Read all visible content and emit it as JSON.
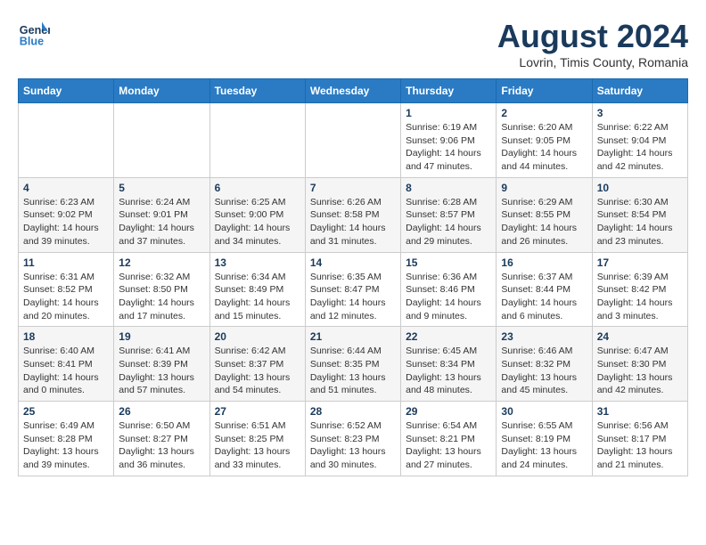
{
  "header": {
    "logo_line1": "General",
    "logo_line2": "Blue",
    "month": "August 2024",
    "location": "Lovrin, Timis County, Romania"
  },
  "weekdays": [
    "Sunday",
    "Monday",
    "Tuesday",
    "Wednesday",
    "Thursday",
    "Friday",
    "Saturday"
  ],
  "weeks": [
    [
      {
        "day": "",
        "info": ""
      },
      {
        "day": "",
        "info": ""
      },
      {
        "day": "",
        "info": ""
      },
      {
        "day": "",
        "info": ""
      },
      {
        "day": "1",
        "info": "Sunrise: 6:19 AM\nSunset: 9:06 PM\nDaylight: 14 hours\nand 47 minutes."
      },
      {
        "day": "2",
        "info": "Sunrise: 6:20 AM\nSunset: 9:05 PM\nDaylight: 14 hours\nand 44 minutes."
      },
      {
        "day": "3",
        "info": "Sunrise: 6:22 AM\nSunset: 9:04 PM\nDaylight: 14 hours\nand 42 minutes."
      }
    ],
    [
      {
        "day": "4",
        "info": "Sunrise: 6:23 AM\nSunset: 9:02 PM\nDaylight: 14 hours\nand 39 minutes."
      },
      {
        "day": "5",
        "info": "Sunrise: 6:24 AM\nSunset: 9:01 PM\nDaylight: 14 hours\nand 37 minutes."
      },
      {
        "day": "6",
        "info": "Sunrise: 6:25 AM\nSunset: 9:00 PM\nDaylight: 14 hours\nand 34 minutes."
      },
      {
        "day": "7",
        "info": "Sunrise: 6:26 AM\nSunset: 8:58 PM\nDaylight: 14 hours\nand 31 minutes."
      },
      {
        "day": "8",
        "info": "Sunrise: 6:28 AM\nSunset: 8:57 PM\nDaylight: 14 hours\nand 29 minutes."
      },
      {
        "day": "9",
        "info": "Sunrise: 6:29 AM\nSunset: 8:55 PM\nDaylight: 14 hours\nand 26 minutes."
      },
      {
        "day": "10",
        "info": "Sunrise: 6:30 AM\nSunset: 8:54 PM\nDaylight: 14 hours\nand 23 minutes."
      }
    ],
    [
      {
        "day": "11",
        "info": "Sunrise: 6:31 AM\nSunset: 8:52 PM\nDaylight: 14 hours\nand 20 minutes."
      },
      {
        "day": "12",
        "info": "Sunrise: 6:32 AM\nSunset: 8:50 PM\nDaylight: 14 hours\nand 17 minutes."
      },
      {
        "day": "13",
        "info": "Sunrise: 6:34 AM\nSunset: 8:49 PM\nDaylight: 14 hours\nand 15 minutes."
      },
      {
        "day": "14",
        "info": "Sunrise: 6:35 AM\nSunset: 8:47 PM\nDaylight: 14 hours\nand 12 minutes."
      },
      {
        "day": "15",
        "info": "Sunrise: 6:36 AM\nSunset: 8:46 PM\nDaylight: 14 hours\nand 9 minutes."
      },
      {
        "day": "16",
        "info": "Sunrise: 6:37 AM\nSunset: 8:44 PM\nDaylight: 14 hours\nand 6 minutes."
      },
      {
        "day": "17",
        "info": "Sunrise: 6:39 AM\nSunset: 8:42 PM\nDaylight: 14 hours\nand 3 minutes."
      }
    ],
    [
      {
        "day": "18",
        "info": "Sunrise: 6:40 AM\nSunset: 8:41 PM\nDaylight: 14 hours\nand 0 minutes."
      },
      {
        "day": "19",
        "info": "Sunrise: 6:41 AM\nSunset: 8:39 PM\nDaylight: 13 hours\nand 57 minutes."
      },
      {
        "day": "20",
        "info": "Sunrise: 6:42 AM\nSunset: 8:37 PM\nDaylight: 13 hours\nand 54 minutes."
      },
      {
        "day": "21",
        "info": "Sunrise: 6:44 AM\nSunset: 8:35 PM\nDaylight: 13 hours\nand 51 minutes."
      },
      {
        "day": "22",
        "info": "Sunrise: 6:45 AM\nSunset: 8:34 PM\nDaylight: 13 hours\nand 48 minutes."
      },
      {
        "day": "23",
        "info": "Sunrise: 6:46 AM\nSunset: 8:32 PM\nDaylight: 13 hours\nand 45 minutes."
      },
      {
        "day": "24",
        "info": "Sunrise: 6:47 AM\nSunset: 8:30 PM\nDaylight: 13 hours\nand 42 minutes."
      }
    ],
    [
      {
        "day": "25",
        "info": "Sunrise: 6:49 AM\nSunset: 8:28 PM\nDaylight: 13 hours\nand 39 minutes."
      },
      {
        "day": "26",
        "info": "Sunrise: 6:50 AM\nSunset: 8:27 PM\nDaylight: 13 hours\nand 36 minutes."
      },
      {
        "day": "27",
        "info": "Sunrise: 6:51 AM\nSunset: 8:25 PM\nDaylight: 13 hours\nand 33 minutes."
      },
      {
        "day": "28",
        "info": "Sunrise: 6:52 AM\nSunset: 8:23 PM\nDaylight: 13 hours\nand 30 minutes."
      },
      {
        "day": "29",
        "info": "Sunrise: 6:54 AM\nSunset: 8:21 PM\nDaylight: 13 hours\nand 27 minutes."
      },
      {
        "day": "30",
        "info": "Sunrise: 6:55 AM\nSunset: 8:19 PM\nDaylight: 13 hours\nand 24 minutes."
      },
      {
        "day": "31",
        "info": "Sunrise: 6:56 AM\nSunset: 8:17 PM\nDaylight: 13 hours\nand 21 minutes."
      }
    ]
  ]
}
